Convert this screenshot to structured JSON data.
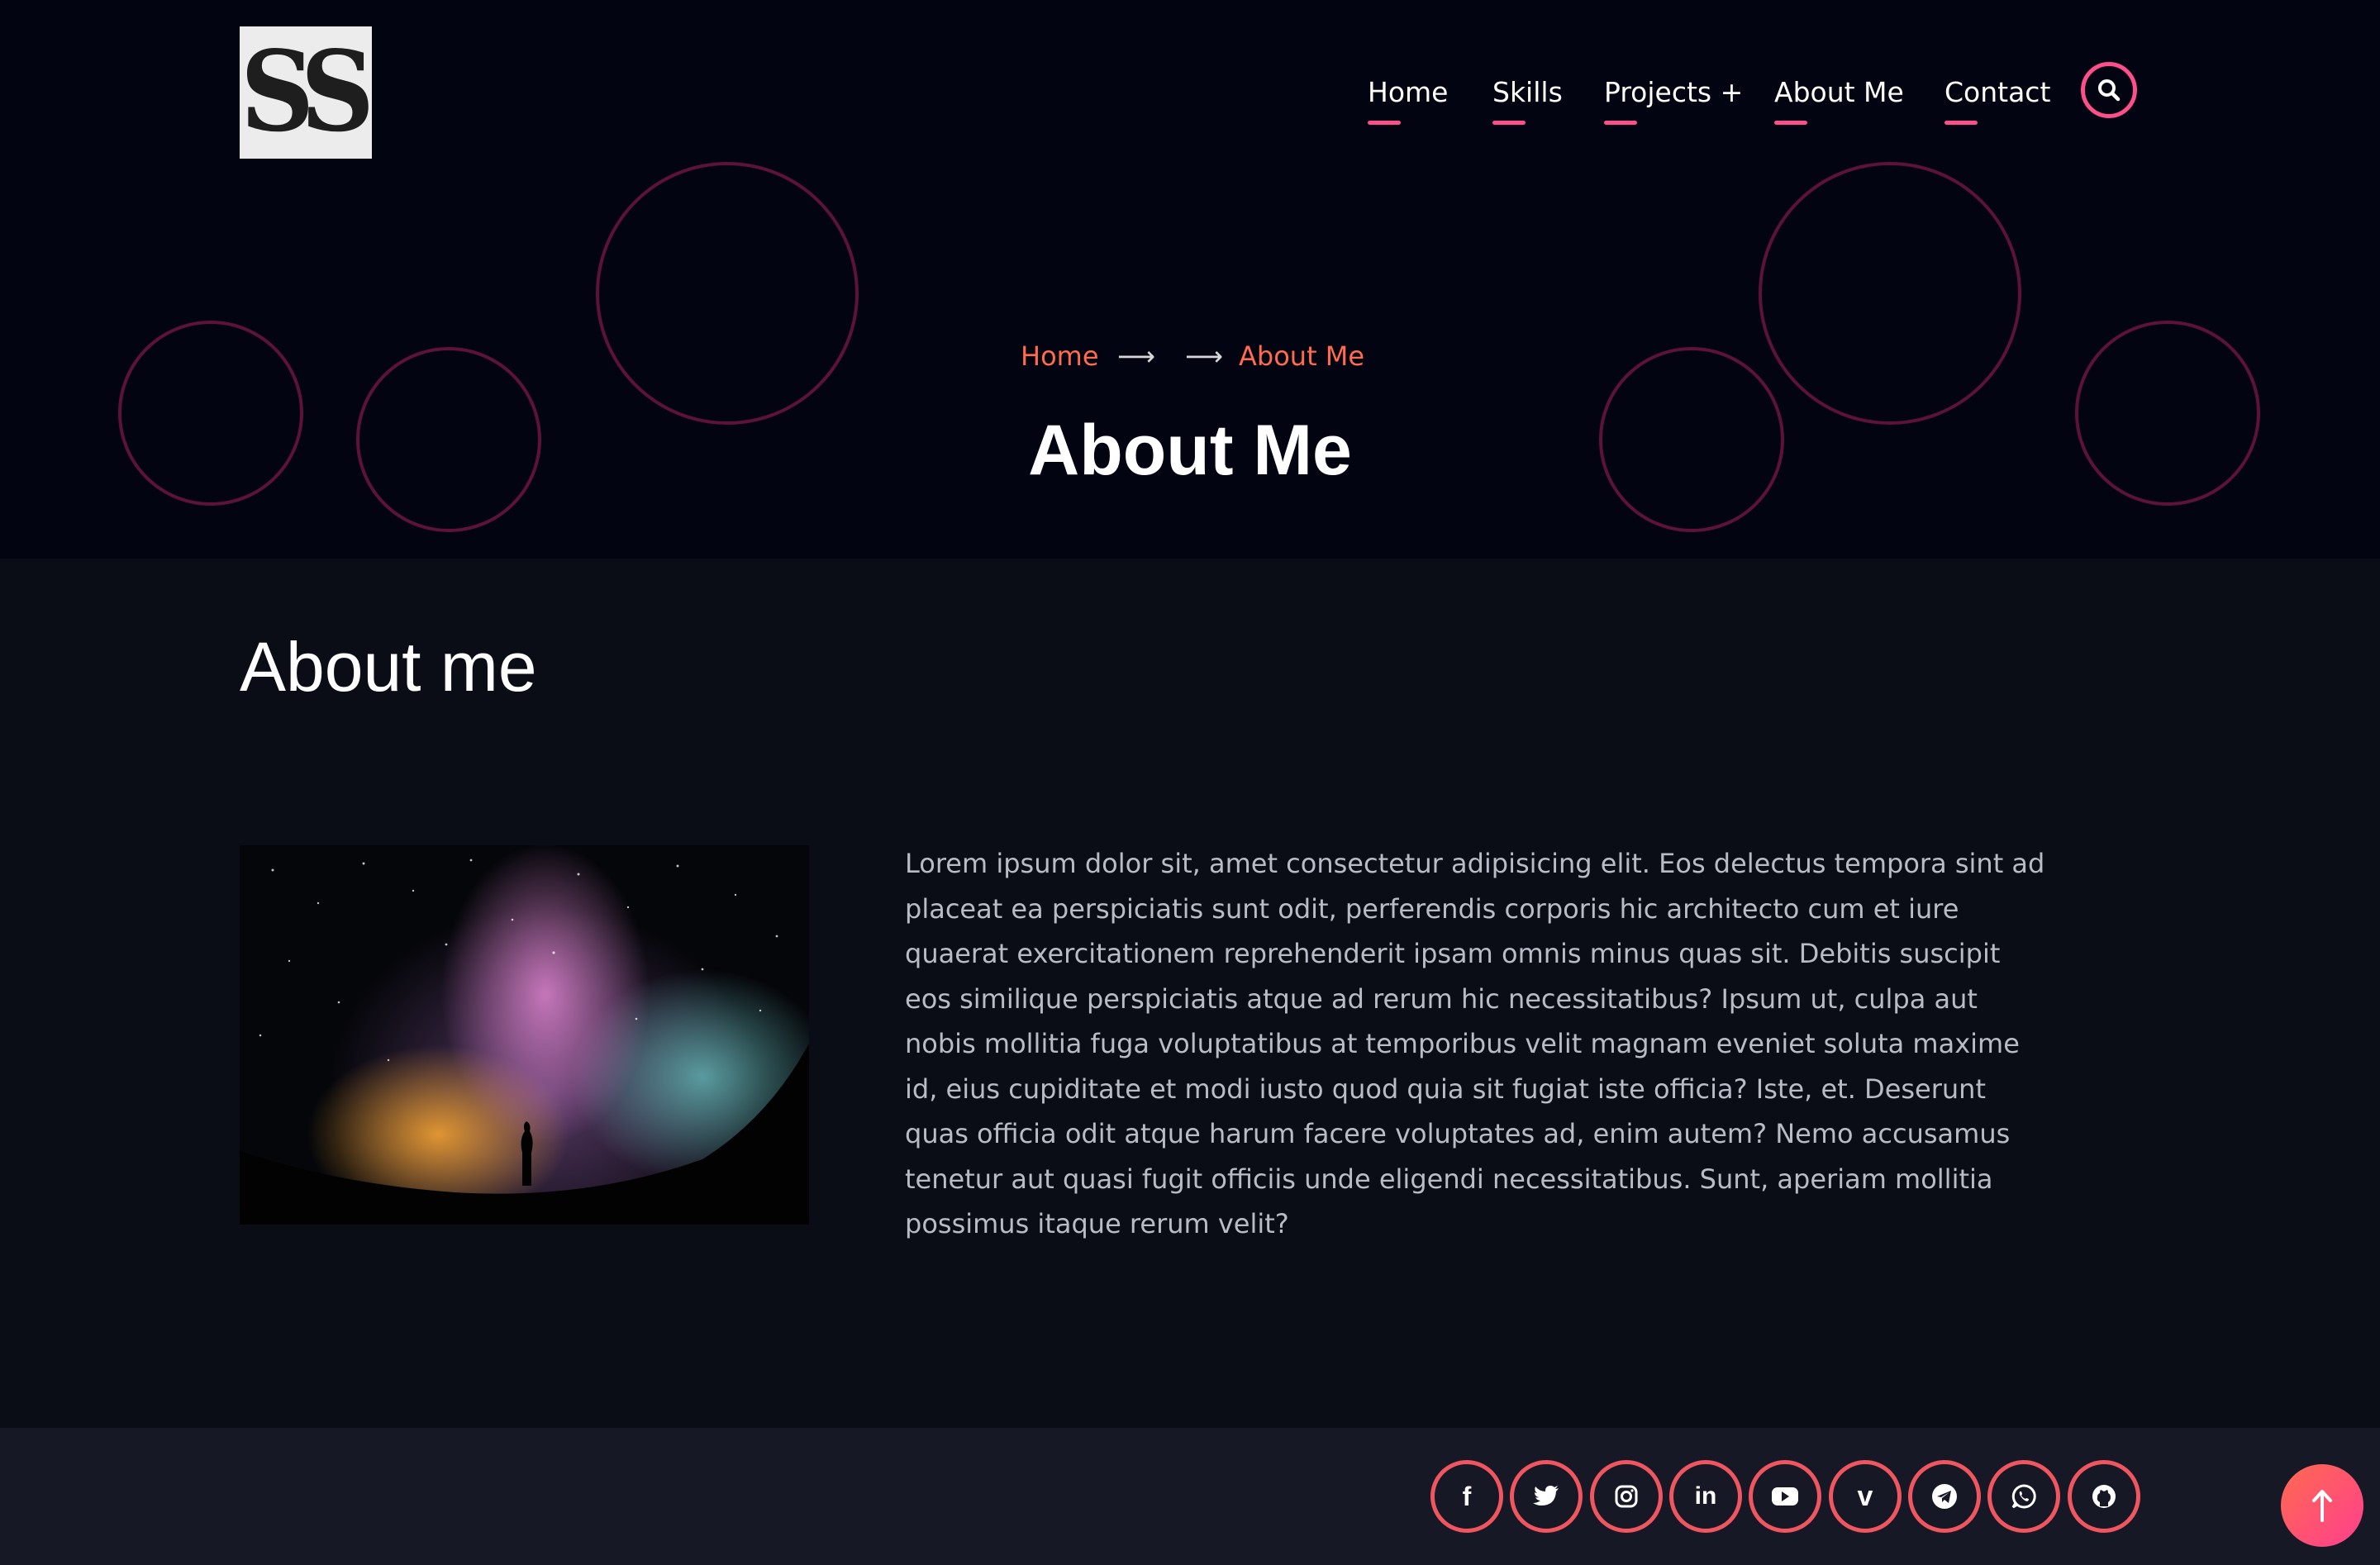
{
  "header": {
    "logo_text": "SS",
    "nav": [
      "Home",
      "Skills",
      "Projects +",
      "About Me",
      "Contact"
    ],
    "search_icon": "search-icon"
  },
  "hero": {
    "breadcrumb": {
      "home": "Home",
      "separator": "⟶",
      "current": "About Me"
    },
    "title": "About Me"
  },
  "main": {
    "section_title": "About me",
    "image": "night-sky-milky-way-photo",
    "paragraph": "Lorem ipsum dolor sit, amet consectetur adipisicing elit. Eos delectus tempora sint ad placeat ea perspiciatis sunt odit, perferendis corporis hic architecto cum et iure quaerat exercitationem reprehenderit ipsam omnis minus quas sit. Debitis suscipit eos similique perspiciatis atque ad rerum hic necessitatibus? Ipsum ut, culpa aut nobis mollitia fuga voluptatibus at temporibus velit magnam eveniet soluta maxime id, eius cupiditate et modi iusto quod quia sit fugiat iste officia? Iste, et. Deserunt quas officia odit atque harum facere voluptates ad, enim autem? Nemo accusamus tenetur aut quasi fugit officiis unde eligendi necessitatibus. Sunt, aperiam mollitia possimus itaque rerum velit?"
  },
  "footer": {
    "social": [
      "facebook-icon",
      "twitter-icon",
      "instagram-icon",
      "linkedin-icon",
      "youtube-icon",
      "vimeo-icon",
      "telegram-icon",
      "whatsapp-icon",
      "github-icon"
    ]
  },
  "colors": {
    "accent": "#ff4f8b",
    "accent_orange": "#ff6a50",
    "hero_bg": "#030412",
    "body_bg": "#0b0d16",
    "footer_bg": "#161925",
    "circle_stroke": "#5c1239"
  }
}
